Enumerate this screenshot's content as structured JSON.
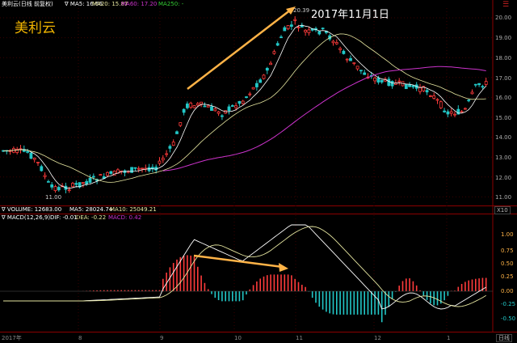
{
  "header": {
    "kline_label": "美利云(日线 前复权)",
    "ma5": "∇ MA5: 16.66",
    "ma20": "MA20: 15.87",
    "ma60": "MA60: 17.20",
    "ma250": "MA250: -",
    "menu_icon": "hamburger-icon",
    "period_label": "日线"
  },
  "stock_name": "美利云",
  "annotation_date": "2017年11月1日",
  "price_labels": {
    "high": "20.39",
    "low": "11.00"
  },
  "price_axis": [
    "20.00",
    "19.00",
    "18.00",
    "17.00",
    "16.00",
    "15.00",
    "14.00",
    "13.00",
    "12.00",
    "11.00"
  ],
  "volume_header": {
    "label": "∇ VOLUME: 12683.00",
    "ma5": "MA5: 28024.74",
    "ma10": "MA10: 25049.21",
    "unit_button": "X10"
  },
  "macd_header": {
    "label": "∇ MACD(12,26,9)",
    "dif": "DIF: -0.01",
    "dea": "DEA: -0.22",
    "macd": "MACD: 0.42"
  },
  "macd_axis": [
    "1.00",
    "0.75",
    "0.50",
    "0.25",
    "0.00",
    "-0.25",
    "-0.50"
  ],
  "x_axis": [
    "2017年",
    "8",
    "9",
    "10",
    "11",
    "12",
    "1"
  ],
  "colors": {
    "up": "#ff3b3b",
    "down": "#22c7c7",
    "ma5": "#ffffff",
    "ma20": "#e6e6a0",
    "ma60": "#cc33cc",
    "ma250": "#33cc33",
    "arrow": "#ffb347",
    "accent": "#f0b400"
  }
}
